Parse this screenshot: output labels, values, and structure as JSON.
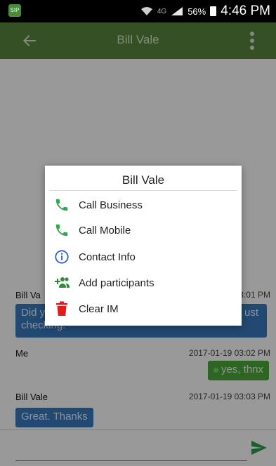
{
  "status_bar": {
    "network": "4G",
    "battery": "56%",
    "time": "4:46 PM"
  },
  "toolbar": {
    "title": "Bill Vale"
  },
  "messages": [
    {
      "sender": "Bill Va",
      "time": "3:01 PM",
      "text_left": "Did y",
      "text_left2": "checking.",
      "text_right": "ust"
    },
    {
      "sender": "Me",
      "time": "2017-01-19 03:02 PM",
      "text": "yes, thnx"
    },
    {
      "sender": "Bill Vale",
      "time": "2017-01-19 03:03 PM",
      "text": "Great. Thanks"
    }
  ],
  "dialog": {
    "title": "Bill Vale",
    "items": [
      {
        "label": "Call Business",
        "icon": "phone-icon",
        "color": "#2fa84f"
      },
      {
        "label": "Call Mobile",
        "icon": "phone-icon",
        "color": "#2fa84f"
      },
      {
        "label": "Contact Info",
        "icon": "info-icon",
        "color": "#2f5fd6"
      },
      {
        "label": "Add participants",
        "icon": "add-people-icon",
        "color": "#2f8a3a"
      },
      {
        "label": "Clear IM",
        "icon": "trash-icon",
        "color": "#e21b1b"
      }
    ]
  },
  "colors": {
    "toolbar": "#58853d",
    "incoming_bubble": "#3a7abf",
    "outgoing_bubble": "#4caa3b",
    "send": "#2d9b48"
  }
}
